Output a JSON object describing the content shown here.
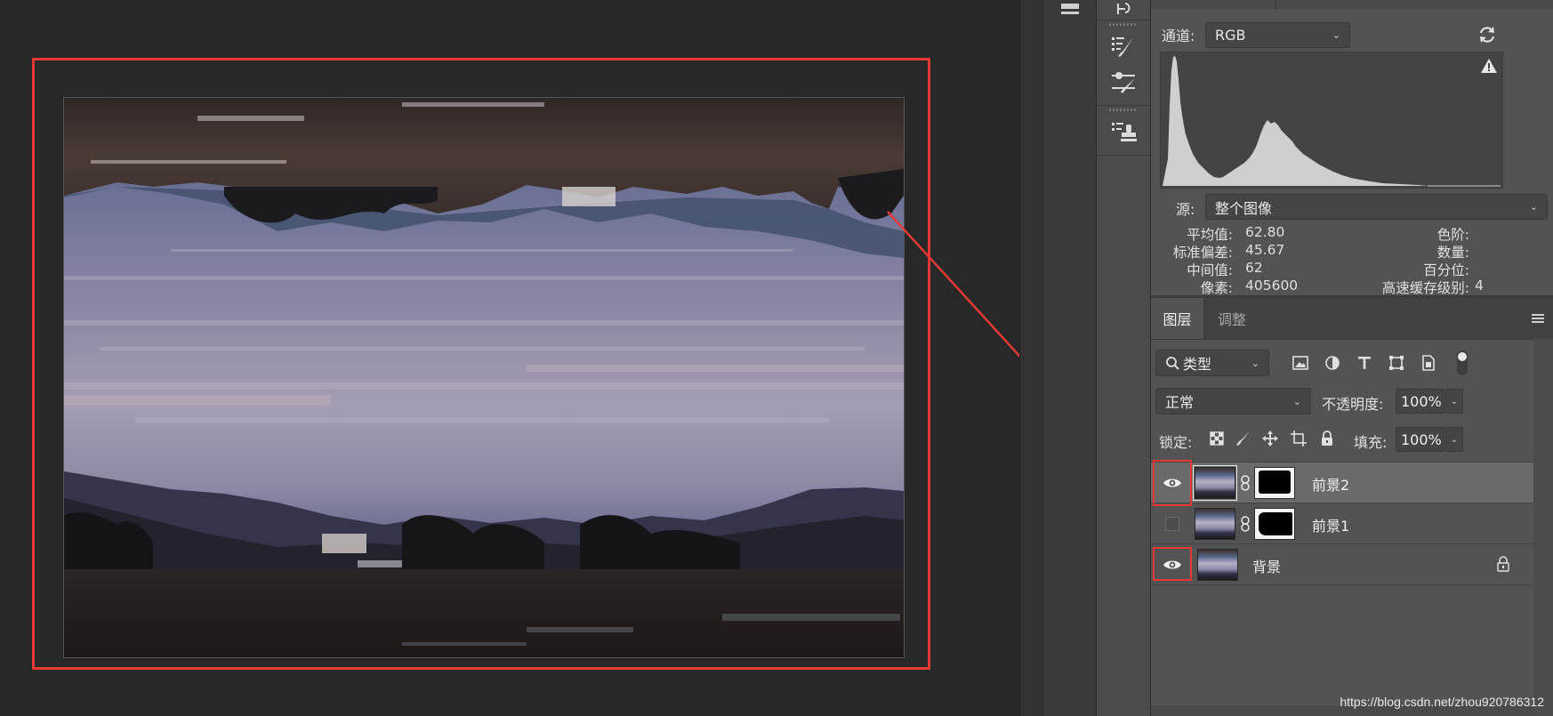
{
  "histogram_panel": {
    "channel_label": "通道:",
    "channel_value": "RGB",
    "source_label": "源:",
    "source_value": "整个图像",
    "stats": {
      "mean_label": "平均值:",
      "mean_value": "62.80",
      "stddev_label": "标准偏差:",
      "stddev_value": "45.67",
      "median_label": "中间值:",
      "median_value": "62",
      "pixels_label": "像素:",
      "pixels_value": "405600",
      "level_label": "色阶:",
      "level_value": "",
      "count_label": "数量:",
      "count_value": "",
      "percentile_label": "百分位:",
      "percentile_value": "",
      "cache_label": "高速缓存级别:",
      "cache_value": "4"
    }
  },
  "layers_panel": {
    "tabs": [
      {
        "label": "图层",
        "active": true
      },
      {
        "label": "调整",
        "active": false
      }
    ],
    "filter_label": "类型",
    "blend_mode": "正常",
    "opacity_label": "不透明度:",
    "opacity_value": "100%",
    "lock_label": "锁定:",
    "fill_label": "填充:",
    "fill_value": "100%",
    "layers": [
      {
        "name": "前景2",
        "visible": true,
        "selected": true,
        "has_mask": true
      },
      {
        "name": "前景1",
        "visible": false,
        "selected": false,
        "has_mask": true
      },
      {
        "name": "背景",
        "visible": true,
        "selected": false,
        "has_mask": false,
        "locked": true
      }
    ]
  },
  "watermark": "https://blog.csdn.net/zhou920786312",
  "colors": {
    "annotation": "#e53935",
    "panel_bg": "#535353",
    "canvas_bg": "#282828"
  },
  "icons": {
    "refresh": "refresh-icon",
    "warning": "warning-icon",
    "visibility": "eye-icon",
    "lock": "lock-icon",
    "link": "chain-link-icon",
    "menu": "hamburger-menu-icon"
  }
}
